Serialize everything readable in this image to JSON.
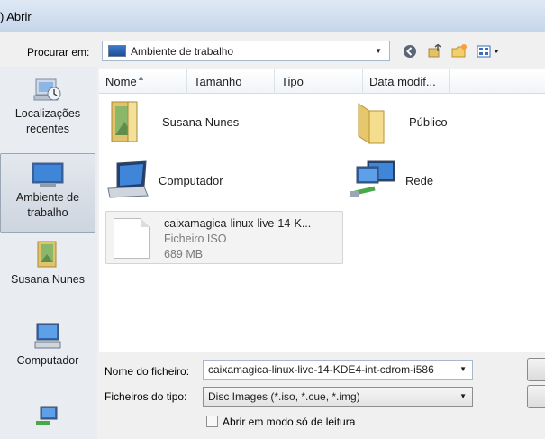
{
  "window": {
    "title": ") Abrir"
  },
  "toolbar": {
    "look_in_label": "Procurar em:",
    "look_in_value": "Ambiente de trabalho",
    "icons": [
      "back-icon",
      "up-folder-icon",
      "new-folder-icon",
      "views-icon"
    ]
  },
  "places": [
    {
      "label": "Localizações recentes",
      "icon": "recent-places-icon"
    },
    {
      "label": "Ambiente de trabalho",
      "icon": "desktop-icon",
      "selected": true
    },
    {
      "label": "Susana Nunes",
      "icon": "user-folder-icon"
    },
    {
      "label": "Computador",
      "icon": "computer-icon"
    }
  ],
  "columns": [
    "Nome",
    "Tamanho",
    "Tipo",
    "Data modif..."
  ],
  "items": [
    {
      "label": "Susana Nunes",
      "icon": "user-folder-icon"
    },
    {
      "label": "Público",
      "icon": "folder-icon"
    },
    {
      "label": "Computador",
      "icon": "computer-icon"
    },
    {
      "label": "Rede",
      "icon": "network-icon"
    }
  ],
  "file_tile": {
    "name": "caixamagica-linux-live-14-K...",
    "type": "Ficheiro ISO",
    "size": "689 MB"
  },
  "bottom": {
    "filename_label": "Nome do ficheiro:",
    "filename_value": "caixamagica-linux-live-14-KDE4-int-cdrom-i586",
    "filetype_label": "Ficheiros do tipo:",
    "filetype_value": "Disc Images (*.iso, *.cue, *.img)",
    "readonly_label": "Abrir em modo só de leitura"
  }
}
